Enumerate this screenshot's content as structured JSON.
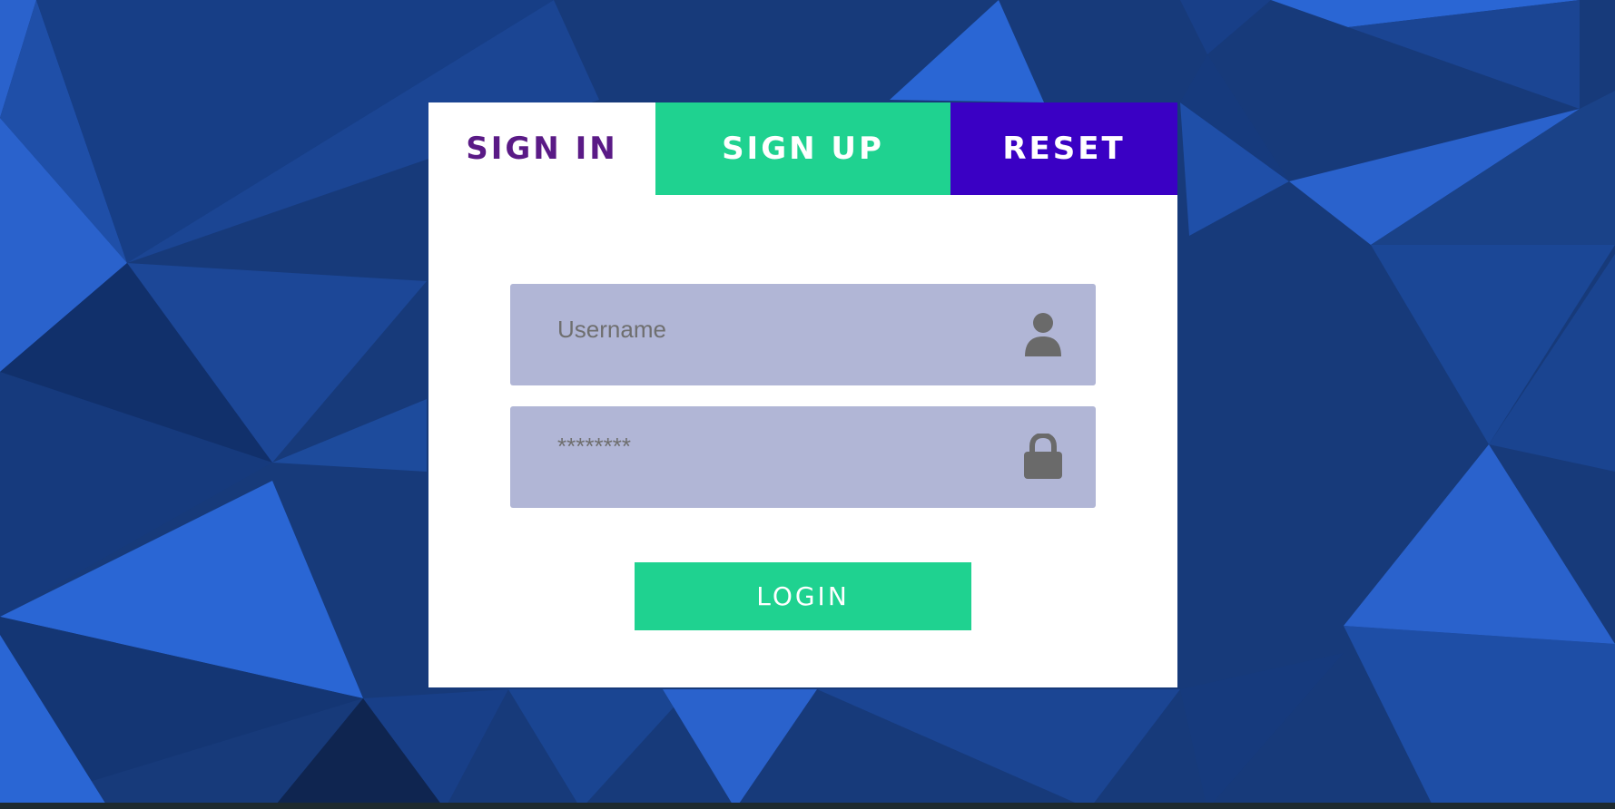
{
  "tabs": [
    {
      "label": "SIGN IN",
      "active": true
    },
    {
      "label": "SIGN UP",
      "active": false
    },
    {
      "label": "RESET",
      "active": false
    }
  ],
  "form": {
    "username": {
      "placeholder": "Username",
      "value": "",
      "icon": "user-icon"
    },
    "password": {
      "placeholder": "********",
      "value": "",
      "icon": "lock-icon"
    },
    "login_label": "LOGIN"
  },
  "colors": {
    "signin_text": "#5a1a86",
    "signup_bg": "#1fd290",
    "reset_bg": "#3a00c4",
    "field_bg": "#b1b6d6",
    "login_bg": "#1fd290",
    "background": "#173a7a"
  }
}
